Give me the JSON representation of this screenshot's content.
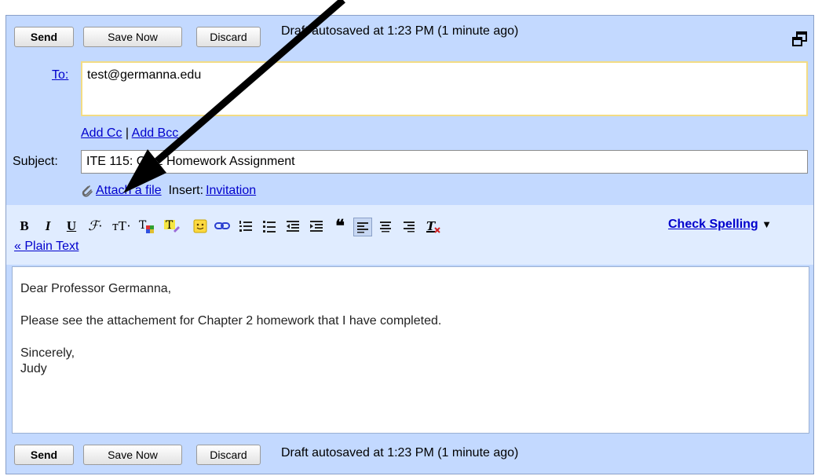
{
  "top_bar": {
    "send_label": "Send",
    "save_label": "Save Now",
    "discard_label": "Discard",
    "status": "Draft autosaved at 1:23 PM (1 minute ago)"
  },
  "to": {
    "label": "To:",
    "value": "test@germanna.edu"
  },
  "cc_links": {
    "add_cc": "Add Cc",
    "separator": "|",
    "add_bcc": "Add Bcc"
  },
  "subject": {
    "label": "Subject:",
    "value": "ITE 115: Ch 2 Homework Assignment"
  },
  "attach": {
    "attach_label": "Attach a file",
    "insert_label": "Insert:",
    "invitation_label": "Invitation"
  },
  "toolbar": {
    "icons": [
      "bold-icon",
      "italic-icon",
      "underline-icon",
      "font-icon",
      "font-size-icon",
      "text-color-icon",
      "highlight-icon",
      "emoticon-icon",
      "link-icon",
      "numbered-list-icon",
      "bullet-list-icon",
      "indent-less-icon",
      "indent-more-icon",
      "quote-icon",
      "align-left-icon",
      "align-center-icon",
      "align-right-icon",
      "remove-formatting-icon"
    ],
    "check_spelling": "Check Spelling",
    "dropdown_arrow": "▼",
    "plain_text": "« Plain Text"
  },
  "message": {
    "greeting": "Dear Professor Germanna,",
    "line1": "Please see the attachement for Chapter 2 homework that I have completed.",
    "closing": "Sincerely,",
    "signature": "Judy"
  },
  "bottom_bar": {
    "send_label": "Send",
    "save_label": "Save Now",
    "discard_label": "Discard",
    "status": "Draft autosaved at 1:23 PM (1 minute ago)"
  },
  "colors": {
    "compose_bg": "#c3d9ff",
    "toolbar_bg": "#e0ecff",
    "link": "#0000cc",
    "to_border": "#f3dc84"
  }
}
